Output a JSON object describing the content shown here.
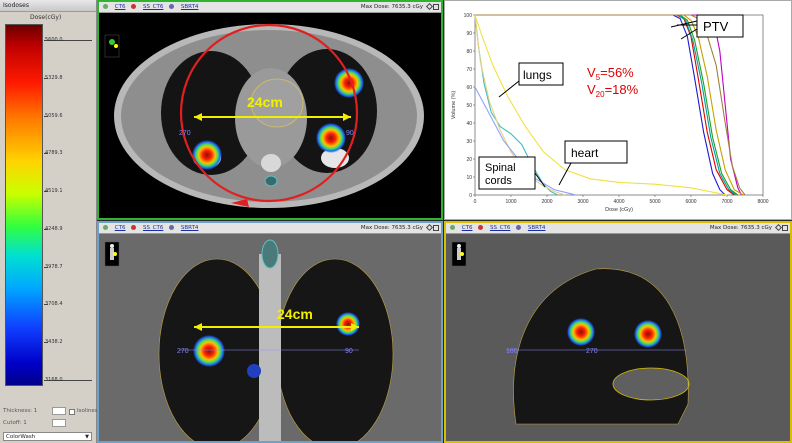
{
  "isodose_panel": {
    "title": "Isodoses",
    "unit": "Dose(cGy)",
    "levels": [
      "5600.0",
      "5329.8",
      "5059.6",
      "4789.3",
      "4519.1",
      "4248.9",
      "3978.7",
      "3708.4",
      "3438.2",
      "3168.0"
    ],
    "thickness_label": "Thickness: 1",
    "cutoff_label": "Cutoff: 1",
    "isolines_label": "Isolines",
    "display_mode": "ColorWash"
  },
  "views": {
    "axial": {
      "tabs": [
        "CT6",
        "SS_CT6",
        "SBRT4"
      ],
      "max_dose": "Max Dose: 7635.3 cGy",
      "measure": "24cm",
      "gantry_left": "270",
      "gantry_right": "90"
    },
    "coronal": {
      "tabs": [
        "CT6",
        "SS_CT6",
        "SBRT4"
      ],
      "max_dose": "Max Dose: 7635.3 cGy",
      "measure": "24cm",
      "gantry_left": "270",
      "gantry_right": "90"
    },
    "sagittal": {
      "tabs": [
        "CT6",
        "SS_CT6",
        "SBRT4"
      ],
      "max_dose": "Max Dose: 7635.3 cGy",
      "gantry_left": "180",
      "gantry_mid": "270"
    }
  },
  "annotations": {
    "ptv": "PTV",
    "lungs": "lungs",
    "heart": "heart",
    "spinal_line1": "Spinal",
    "spinal_line2": "cords",
    "v5_main": "V",
    "v5_sub": "5",
    "v5_val": "=56%",
    "v20_main": "V",
    "v20_sub": "20",
    "v20_val": "=18%"
  },
  "chart_data": {
    "type": "line",
    "xlabel": "Dose (cGy)",
    "ylabel": "Volume (%)",
    "xlim": [
      0,
      8000
    ],
    "ylim": [
      0,
      100
    ],
    "xticks": [
      "0",
      "1000",
      "2000",
      "3000",
      "4000",
      "5000",
      "6000",
      "7000",
      "8000"
    ],
    "yticks": [
      "0",
      "10",
      "20",
      "30",
      "40",
      "50",
      "60",
      "70",
      "80",
      "90",
      "100"
    ],
    "grid": false,
    "series": [
      {
        "color": "#c000c0",
        "x": [
          0,
          6300,
          6500,
          6650,
          6800,
          6950,
          7100,
          7300,
          7400
        ],
        "y": [
          100,
          100,
          99,
          95,
          80,
          50,
          20,
          4,
          0
        ]
      },
      {
        "color": "#e00000",
        "x": [
          0,
          5600,
          5800,
          6000,
          6200,
          6450,
          6700,
          7000,
          7200
        ],
        "y": [
          100,
          100,
          98,
          88,
          65,
          35,
          14,
          3,
          0
        ]
      },
      {
        "color": "#1a1ad0",
        "x": [
          0,
          5500,
          5700,
          5900,
          6100,
          6350,
          6600,
          6800,
          6950
        ],
        "y": [
          100,
          100,
          98,
          88,
          65,
          35,
          12,
          3,
          0
        ]
      },
      {
        "color": "#00a0a0",
        "x": [
          0,
          5650,
          5850,
          6050,
          6300,
          6550,
          6800,
          7050,
          7250
        ],
        "y": [
          100,
          100,
          97,
          86,
          62,
          32,
          12,
          3,
          0
        ]
      },
      {
        "color": "#20a020",
        "x": [
          0,
          5700,
          5900,
          6100,
          6350,
          6600,
          6850,
          7100,
          7300
        ],
        "y": [
          100,
          100,
          97,
          86,
          62,
          32,
          12,
          3,
          0
        ]
      },
      {
        "color": "#c8a000",
        "x": [
          0,
          5800,
          6000,
          6200,
          6450,
          6700,
          6950,
          7200,
          7450
        ],
        "y": [
          100,
          100,
          97,
          88,
          66,
          36,
          14,
          3,
          0
        ]
      },
      {
        "color": "#a08040",
        "x": [
          0,
          6000,
          6200,
          6400,
          6700,
          6950,
          7150,
          7350,
          7500
        ],
        "y": [
          100,
          100,
          98,
          92,
          72,
          40,
          16,
          4,
          0
        ]
      },
      {
        "color": "#40c0c0",
        "x": [
          0,
          100,
          250,
          450,
          700,
          1000,
          1300,
          1600,
          1900,
          2100,
          2300
        ],
        "y": [
          100,
          82,
          62,
          46,
          38,
          34,
          28,
          16,
          6,
          2,
          0
        ]
      },
      {
        "color": "#f0e040",
        "x": [
          0,
          200,
          500,
          900,
          1400,
          1900,
          2500,
          3200,
          4000,
          5000,
          6000,
          7000
        ],
        "y": [
          100,
          88,
          72,
          55,
          38,
          24,
          14,
          9,
          7,
          6,
          4,
          0
        ]
      },
      {
        "color": "#e8d080",
        "x": [
          0,
          150,
          400,
          700,
          1000,
          1300,
          1600,
          1900,
          2200,
          2500
        ],
        "y": [
          100,
          74,
          52,
          36,
          24,
          15,
          9,
          5,
          2,
          0
        ]
      },
      {
        "color": "#90a0ff",
        "x": [
          0,
          800,
          1600,
          2200,
          2600,
          2800
        ],
        "y": [
          60,
          30,
          10,
          3,
          1,
          0
        ]
      }
    ]
  }
}
